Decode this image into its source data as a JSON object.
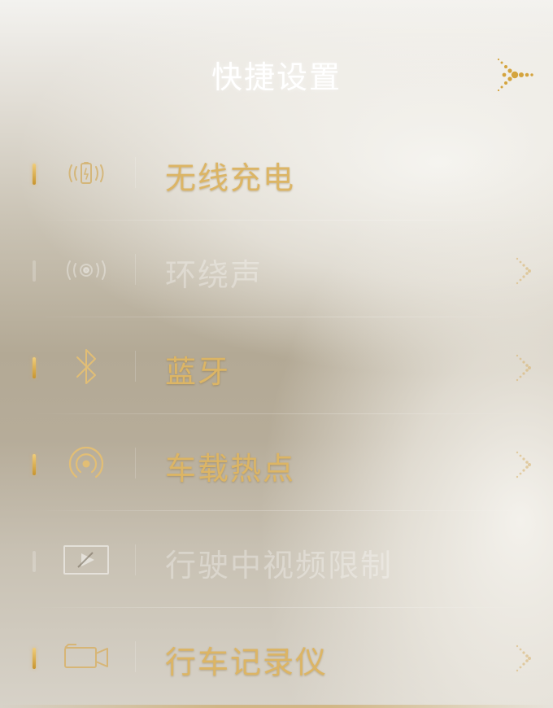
{
  "header": {
    "title": "快捷设置",
    "back_icon": "back-arrow-icon"
  },
  "colors": {
    "accent_gold": "#dcb565",
    "title_white": "#ffffff"
  },
  "items": [
    {
      "label": "无线充电",
      "icon": "wireless-charging-icon",
      "enabled": true,
      "has_chevron": false
    },
    {
      "label": "环绕声",
      "icon": "surround-sound-icon",
      "enabled": false,
      "has_chevron": true
    },
    {
      "label": "蓝牙",
      "icon": "bluetooth-icon",
      "enabled": true,
      "has_chevron": true
    },
    {
      "label": "车载热点",
      "icon": "hotspot-icon",
      "enabled": true,
      "has_chevron": true
    },
    {
      "label": "行驶中视频限制",
      "icon": "video-restriction-icon",
      "enabled": false,
      "has_chevron": false
    },
    {
      "label": "行车记录仪",
      "icon": "dashcam-icon",
      "enabled": true,
      "has_chevron": true
    }
  ]
}
